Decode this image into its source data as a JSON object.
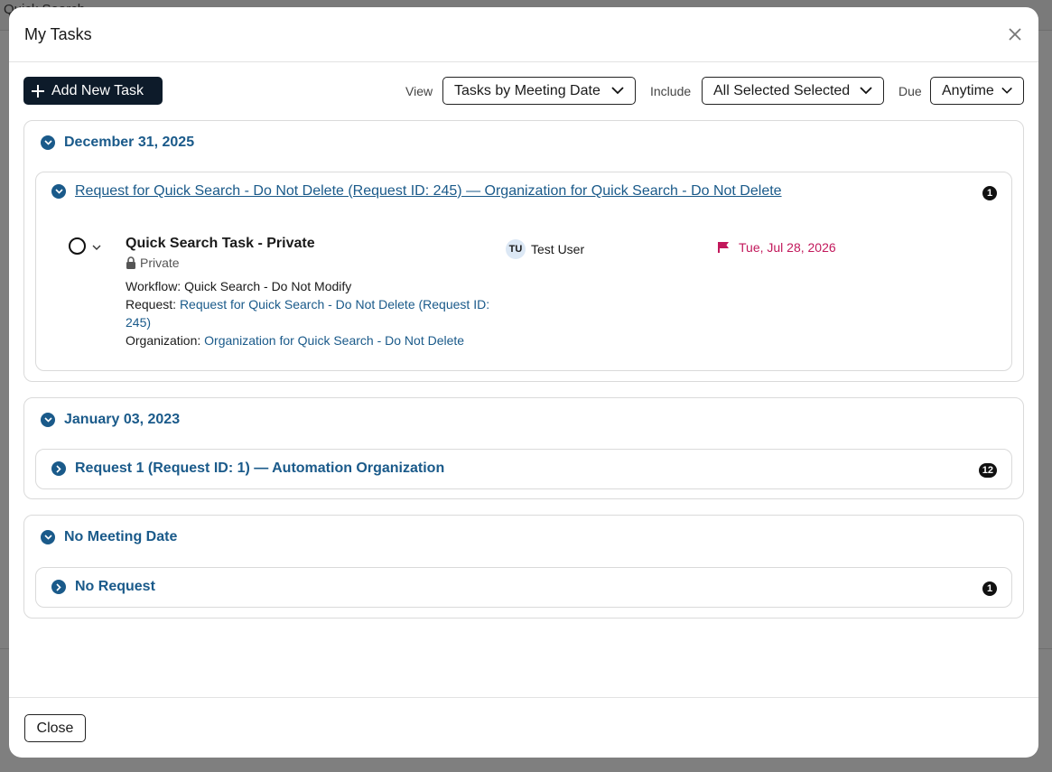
{
  "background": {
    "topbar_text": "Quick Search"
  },
  "modal": {
    "title": "My Tasks",
    "add_task_label": "Add New Task",
    "filters": {
      "view_label": "View",
      "view_value": "Tasks by Meeting Date",
      "include_label": "Include",
      "include_value": "All Selected Selected",
      "due_label": "Due",
      "due_value": "Anytime"
    },
    "groups": [
      {
        "date": "December 31, 2025",
        "requests": [
          {
            "title": "Request for Quick Search - Do Not Delete (Request ID: 245) — Organization for Quick Search - Do Not Delete",
            "count": "1",
            "task": {
              "title": "Quick Search Task - Private",
              "privacy": "Private",
              "workflow_label": "Workflow:",
              "workflow_value": "Quick Search - Do Not Modify",
              "request_label": "Request:",
              "request_value": "Request for Quick Search - Do Not Delete (Request ID: 245)",
              "org_label": "Organization:",
              "org_value": "Organization for Quick Search - Do Not Delete",
              "assignee_initials": "TU",
              "assignee_name": "Test User",
              "due_date": "Tue, Jul 28, 2026"
            }
          }
        ]
      },
      {
        "date": "January 03, 2023",
        "requests": [
          {
            "title": "Request 1 (Request ID: 1) — Automation Organization",
            "count": "12"
          }
        ]
      },
      {
        "date": "No Meeting Date",
        "requests": [
          {
            "title": "No Request",
            "count": "1"
          }
        ]
      }
    ],
    "close_label": "Close"
  },
  "colors": {
    "accent": "#1a5a8a",
    "primary_button": "#0d1b2a",
    "due_flag": "#c2185b"
  }
}
